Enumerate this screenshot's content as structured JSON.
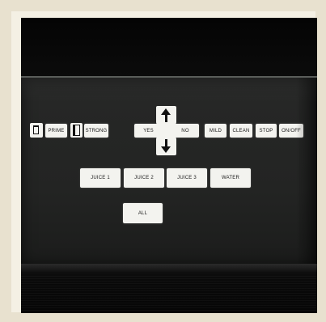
{
  "panel": {
    "top_row": {
      "prime": "PRIME",
      "strong": "STRONG",
      "yes": "YES",
      "no": "NO",
      "mild": "MILD",
      "clean": "CLEAN",
      "stop": "STOP",
      "onoff": "ON/OFF"
    },
    "juice_row": {
      "juice1": "JUICE 1",
      "juice2": "JUICE 2",
      "juice3": "JUICE 3",
      "water": "WATER"
    },
    "all": "ALL"
  },
  "icons": {
    "cup_small": "small-cup-icon",
    "cup_large": "large-cup-icon",
    "arrow_up": "arrow-up-icon",
    "arrow_down": "arrow-down-icon"
  },
  "colors": {
    "button_face": "#f3f3ef",
    "screen": "#232423",
    "bezel": "#050505"
  }
}
